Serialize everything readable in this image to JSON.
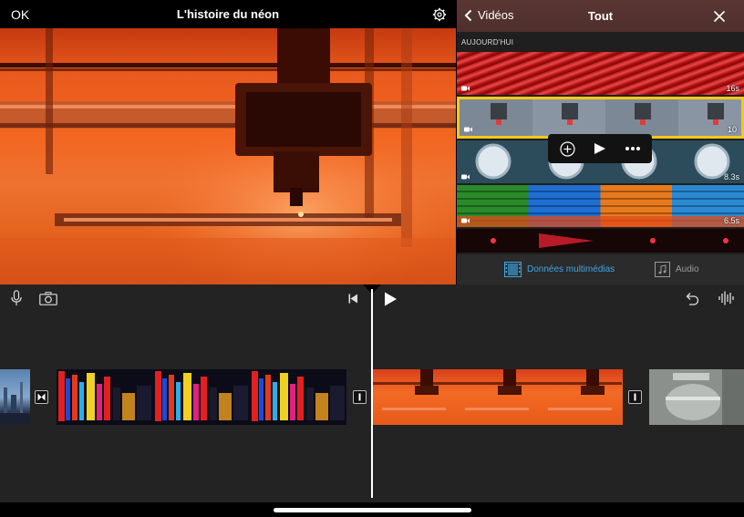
{
  "app": {
    "ok_label": "OK",
    "project_title": "L'histoire du néon"
  },
  "browser": {
    "back_label": "Vidéos",
    "title": "Tout",
    "section_label": "AUJOURD'HUI",
    "clips": [
      {
        "name": "red-neon-tubes",
        "duration": "16s"
      },
      {
        "name": "laser-cutter",
        "duration": "10"
      },
      {
        "name": "portholes",
        "duration": "8.3s"
      },
      {
        "name": "colored-neon",
        "duration": "6.5s"
      },
      {
        "name": "red-lights",
        "duration": ""
      }
    ],
    "selected_clip_index": 1,
    "popover_actions": [
      "add",
      "play",
      "more"
    ],
    "tabs": [
      {
        "label": "Données multimédias",
        "icon": "film-strip-icon",
        "active": true
      },
      {
        "label": "Audio",
        "icon": "music-note-icon",
        "active": false
      }
    ],
    "active_tab_color": "#3fa7e4"
  },
  "toolbar": {
    "left_icons": [
      "microphone-icon",
      "camera-icon"
    ],
    "center_icons": [
      "skip-to-start-icon",
      "play-icon"
    ],
    "right_icons": [
      "undo-icon",
      "audio-waveform-icon"
    ]
  },
  "timeline": {
    "clips": [
      "city-skyline",
      "neon-signs",
      "laser-cutter",
      "industrial-machine"
    ],
    "transitions": [
      "cross-dissolve-icon",
      "no-transition-icon",
      "no-transition-icon"
    ]
  },
  "colors": {
    "accent_yellow": "#f3c81a",
    "viewer_orange": "#f2651f",
    "header_red_brown": "#543230"
  }
}
